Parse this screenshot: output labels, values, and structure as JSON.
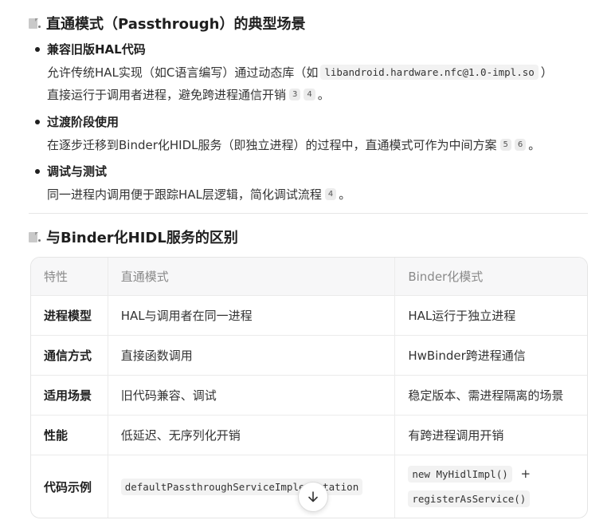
{
  "section1": {
    "title": "直通模式（Passthrough）的典型场景",
    "items": [
      {
        "title": "兼容旧版HAL代码",
        "line1_before": "允许传统HAL实现（如C语言编写）通过动态库（如",
        "line1_code": "libandroid.hardware.nfc@1.0-impl.so",
        "line1_after": "）",
        "line2_text": "直接运行于调用者进程，避免跨进程通信开销",
        "line2_cites": [
          "3",
          "4"
        ],
        "line2_end": "。"
      },
      {
        "title": "过渡阶段使用",
        "line1_text": "在逐步迁移到Binder化HIDL服务（即独立进程）的过程中，直通模式可作为中间方案",
        "line1_cites": [
          "5",
          "6"
        ],
        "line1_end": "。"
      },
      {
        "title": "调试与测试",
        "line1_text": "同一进程内调用便于跟踪HAL层逻辑，简化调试流程",
        "line1_cites": [
          "4"
        ],
        "line1_end": "。"
      }
    ]
  },
  "section2": {
    "title": "与Binder化HIDL服务的区别"
  },
  "table": {
    "headers": [
      "特性",
      "直通模式",
      "Binder化模式"
    ],
    "rows": [
      [
        "进程模型",
        "HAL与调用者在同一进程",
        "HAL运行于独立进程"
      ],
      [
        "通信方式",
        "直接函数调用",
        "HwBinder跨进程通信"
      ],
      [
        "适用场景",
        "旧代码兼容、调试",
        "稳定版本、需进程隔离的场景"
      ],
      [
        "性能",
        "低延迟、无序列化开销",
        "有跨进程调用开销"
      ]
    ],
    "code_row": {
      "feature": "代码示例",
      "passthrough_code": "defaultPassthroughServiceImplementation",
      "binder_code_1": "new MyHidlImpl()",
      "binder_plus": "+",
      "binder_code_2": "registerAsService()"
    }
  },
  "icons": {
    "section_icon": "document-icon",
    "scroll_icon": "arrow-down-icon"
  }
}
